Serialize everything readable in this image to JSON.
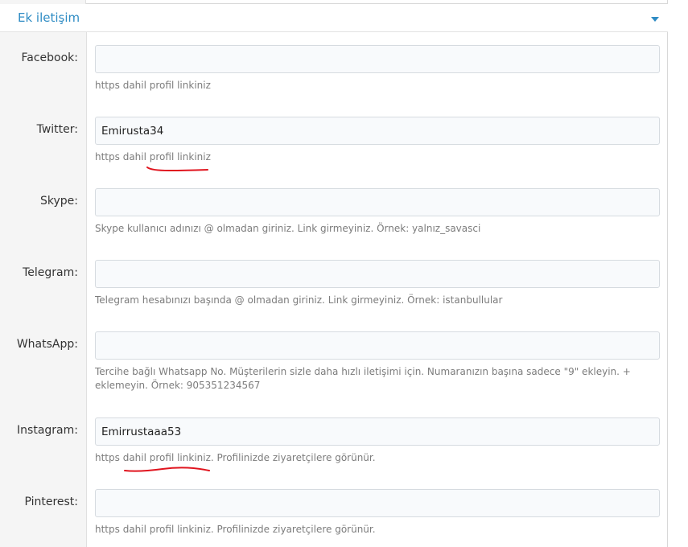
{
  "section": {
    "title": "Ek iletişim"
  },
  "fields": [
    {
      "label": "Facebook:",
      "value": "",
      "hint": "https dahil profil linkiniz"
    },
    {
      "label": "Twitter:",
      "value": "Emirusta34",
      "hint": "https dahil profil linkiniz"
    },
    {
      "label": "Skype:",
      "value": "",
      "hint": "Skype kullanıcı adınızı @ olmadan giriniz. Link girmeyiniz. Örnek: yalnız_savasci"
    },
    {
      "label": "Telegram:",
      "value": "",
      "hint": "Telegram hesabınızı başında @ olmadan giriniz. Link girmeyiniz. Örnek: istanbullular"
    },
    {
      "label": "WhatsApp:",
      "value": "",
      "hint": "Tercihe bağlı Whatsapp No. Müşterilerin sizle daha hızlı iletişimi için. Numaranızın başına sadece \"9\" ekleyin. + eklemeyin. Örnek: 905351234567"
    },
    {
      "label": "Instagram:",
      "value": "Emirrustaaa53",
      "hint": "https dahil profil linkiniz. Profilinizde ziyaretçilere görünür."
    },
    {
      "label": "Pinterest:",
      "value": "",
      "hint": "https dahil profil linkiniz. Profilinizde ziyaretçilere görünür."
    }
  ],
  "annotation_color": "#e0141e"
}
